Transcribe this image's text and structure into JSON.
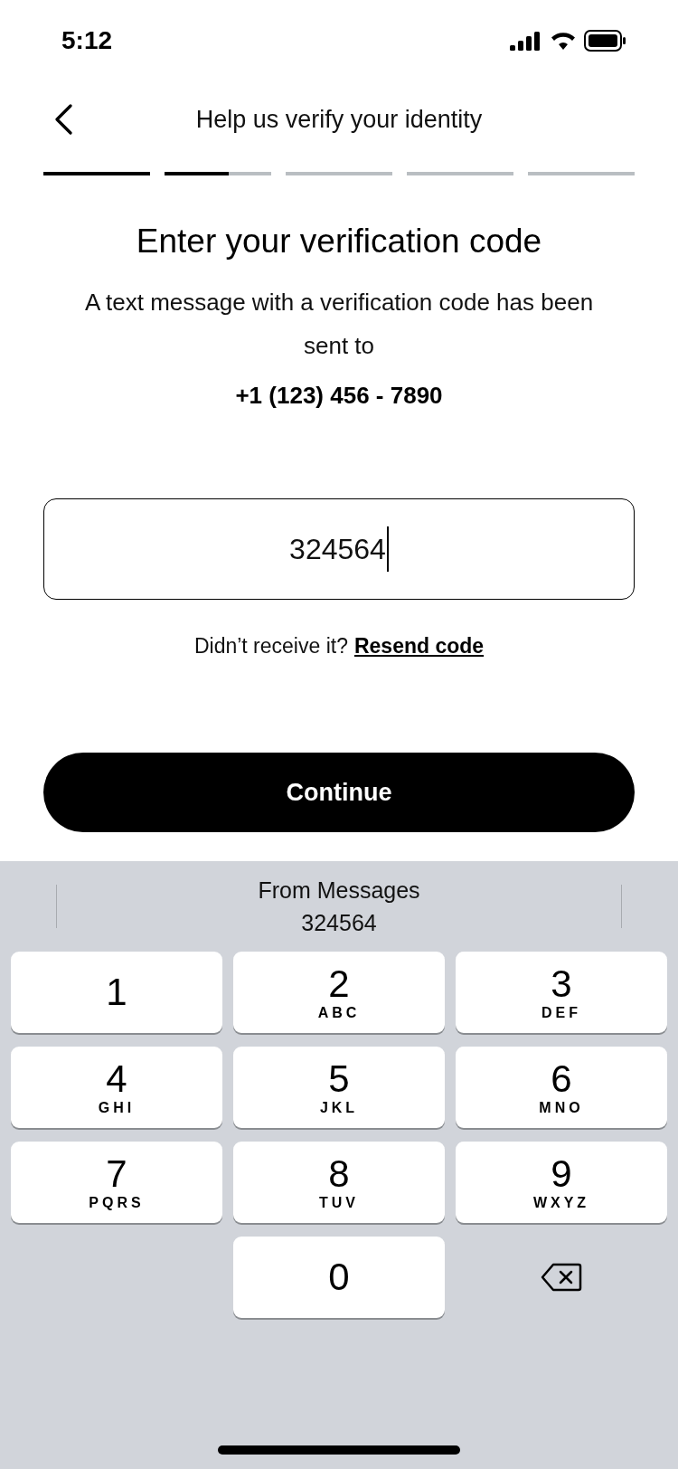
{
  "status_bar": {
    "time": "5:12"
  },
  "header": {
    "title": "Help us verify your identity"
  },
  "progress": [
    {
      "kind": "complete"
    },
    {
      "kind": "current",
      "level": 0.6
    },
    {
      "kind": "upcoming"
    },
    {
      "kind": "upcoming"
    },
    {
      "kind": "upcoming"
    }
  ],
  "heading": "Enter your verification code",
  "message": "A text message with a verification code has been sent to",
  "phone": "+1 (123) 456 - 7890",
  "code_field": {
    "value": "324564",
    "focused": true
  },
  "resend": {
    "prompt": "Didn’t receive it?",
    "link": "Resend code"
  },
  "continue_button": "Continue",
  "keyboard": {
    "suggestion": {
      "source": "From Messages",
      "code": "324564"
    },
    "keys": [
      {
        "kind": "digit",
        "digit": "1"
      },
      {
        "kind": "digit",
        "digit": "2",
        "letters": "ABC"
      },
      {
        "kind": "digit",
        "digit": "3",
        "letters": "DEF"
      },
      {
        "kind": "digit",
        "digit": "4",
        "letters": "GHI"
      },
      {
        "kind": "digit",
        "digit": "5",
        "letters": "JKL"
      },
      {
        "kind": "digit",
        "digit": "6",
        "letters": "MNO"
      },
      {
        "kind": "digit",
        "digit": "7",
        "letters": "PQRS"
      },
      {
        "kind": "digit",
        "digit": "8",
        "letters": "TUV"
      },
      {
        "kind": "digit",
        "digit": "9",
        "letters": "WXYZ"
      },
      {
        "kind": "blank"
      },
      {
        "kind": "digit",
        "digit": "0"
      },
      {
        "kind": "delete"
      }
    ]
  }
}
